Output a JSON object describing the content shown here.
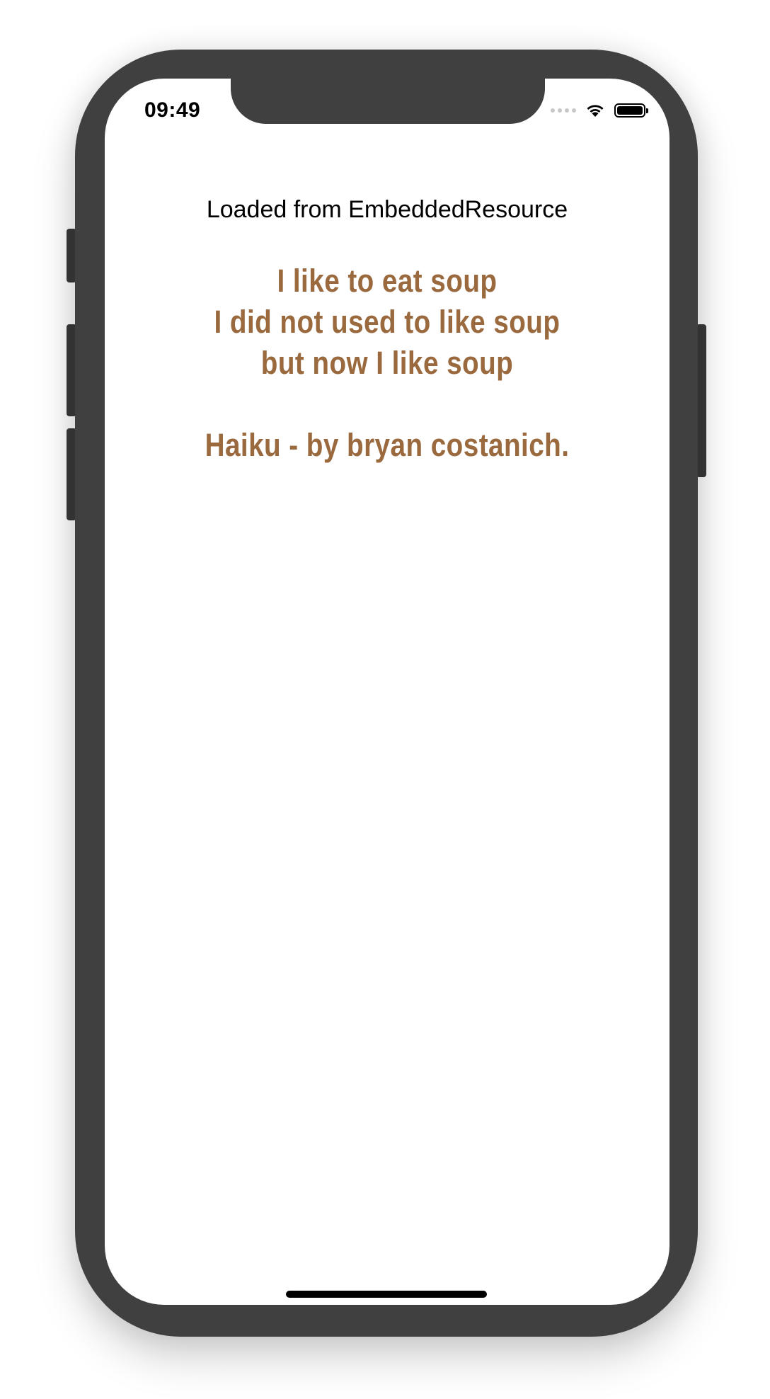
{
  "status_bar": {
    "time": "09:49",
    "icons": [
      "signal-dots-icon",
      "wifi-icon",
      "battery-icon"
    ]
  },
  "page": {
    "subtitle": "Loaded from EmbeddedResource",
    "haiku_lines": [
      "I like to eat soup",
      "I did not used to like soup",
      "but now I like soup"
    ],
    "attribution": "Haiku - by bryan costanich."
  },
  "colors": {
    "phone_frame": "#404040",
    "haiku_text": "#9a6a3e",
    "background": "#ffffff"
  }
}
